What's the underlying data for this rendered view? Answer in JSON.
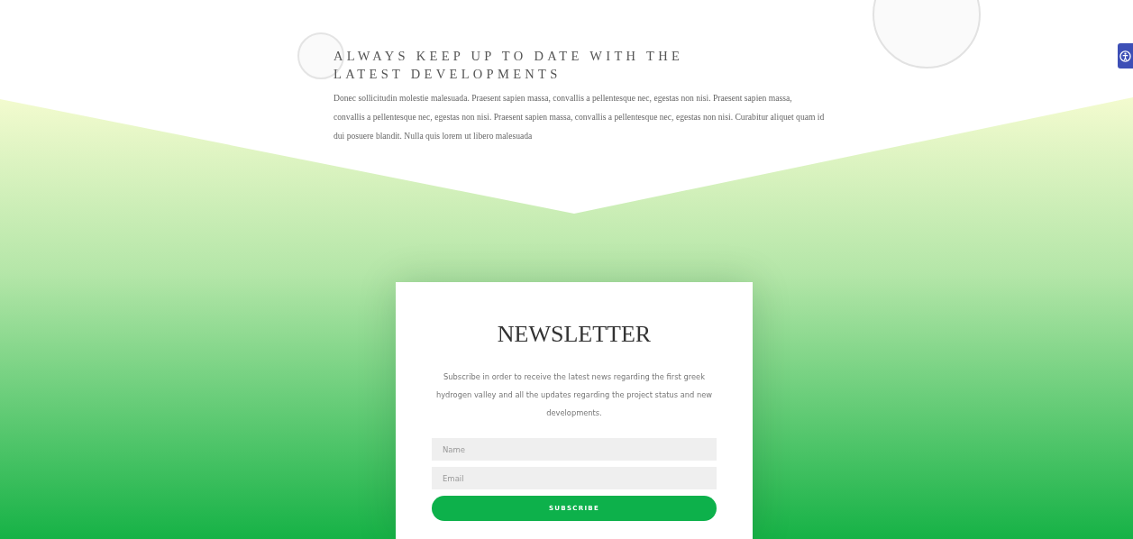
{
  "intro": {
    "heading": "ALWAYS KEEP UP TO DATE WITH THE LATEST DEVELOPMENTS",
    "text": "Donec sollicitudin molestie malesuada. Praesent sapien massa, convallis a pellentesque nec, egestas non nisi. Praesent sapien massa, convallis a pellentesque nec, egestas non nisi. Praesent sapien massa, convallis a pellentesque nec, egestas non nisi. Curabitur aliquet quam id dui posuere blandit. Nulla quis lorem ut libero malesuada"
  },
  "newsletter": {
    "title": "NEWSLETTER",
    "text": "Subscribe in order to receive the latest news regarding the first greek hydrogen valley and all the updates regarding the project status and new developments.",
    "fields": [
      {
        "placeholder": "Name"
      },
      {
        "placeholder": "Email"
      }
    ],
    "button": "SUBSCRIBE"
  }
}
